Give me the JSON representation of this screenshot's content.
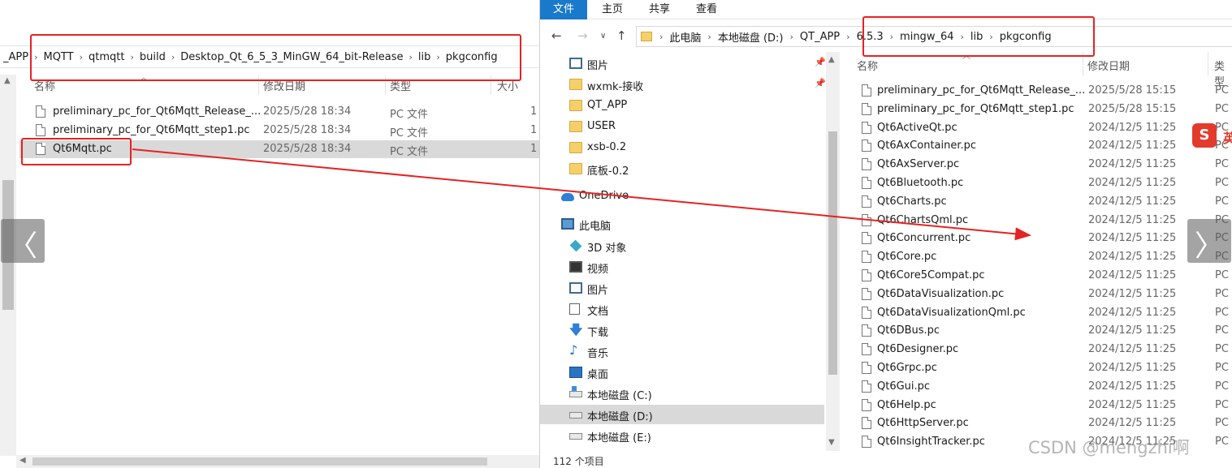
{
  "left_window": {
    "breadcrumbs": [
      "_APP",
      "MQTT",
      "qtmqtt",
      "build",
      "Desktop_Qt_6_5_3_MinGW_64_bit-Release",
      "lib",
      "pkgconfig"
    ],
    "columns": {
      "name": "名称",
      "date": "修改日期",
      "type": "类型",
      "size": "大小"
    },
    "files": [
      {
        "name": "preliminary_pc_for_Qt6Mqtt_Release_...",
        "date": "2025/5/28 18:34",
        "type": "PC 文件",
        "size": "1"
      },
      {
        "name": "preliminary_pc_for_Qt6Mqtt_step1.pc",
        "date": "2025/5/28 18:34",
        "type": "PC 文件",
        "size": "1"
      },
      {
        "name": "Qt6Mqtt.pc",
        "date": "2025/5/28 18:34",
        "type": "PC 文件",
        "size": "1"
      }
    ]
  },
  "right_window": {
    "ribbon_tabs": [
      "文件",
      "主页",
      "共享",
      "查看"
    ],
    "breadcrumbs": [
      "此电脑",
      "本地磁盘 (D:)",
      "QT_APP",
      "6.5.3",
      "mingw_64",
      "lib",
      "pkgconfig"
    ],
    "nav_items": [
      {
        "label": "图片",
        "icon": "image-icon",
        "pinned": true
      },
      {
        "label": "wxmk-接收",
        "icon": "folder-icon",
        "pinned": true
      },
      {
        "label": "QT_APP",
        "icon": "folder-icon"
      },
      {
        "label": "USER",
        "icon": "folder-icon"
      },
      {
        "label": "xsb-0.2",
        "icon": "folder-icon"
      },
      {
        "label": "底板-0.2",
        "icon": "folder-icon"
      },
      {
        "label": "OneDrive",
        "icon": "cloud-icon"
      },
      {
        "label": "此电脑",
        "icon": "computer-icon"
      },
      {
        "label": "3D 对象",
        "icon": "cube-icon"
      },
      {
        "label": "视频",
        "icon": "video-icon"
      },
      {
        "label": "图片",
        "icon": "image-icon"
      },
      {
        "label": "文档",
        "icon": "document-icon"
      },
      {
        "label": "下载",
        "icon": "download-icon"
      },
      {
        "label": "音乐",
        "icon": "music-icon"
      },
      {
        "label": "桌面",
        "icon": "desktop-icon"
      },
      {
        "label": "本地磁盘 (C:)",
        "icon": "drive-c-icon"
      },
      {
        "label": "本地磁盘 (D:)",
        "icon": "drive-icon",
        "selected": true
      },
      {
        "label": "本地磁盘 (E:)",
        "icon": "drive-icon"
      }
    ],
    "columns": {
      "name": "名称",
      "date": "修改日期",
      "type": "类型"
    },
    "files": [
      {
        "name": "preliminary_pc_for_Qt6Mqtt_Release_...",
        "date": "2025/5/28 15:15",
        "type": "PC"
      },
      {
        "name": "preliminary_pc_for_Qt6Mqtt_step1.pc",
        "date": "2025/5/28 15:15",
        "type": "PC"
      },
      {
        "name": "Qt6ActiveQt.pc",
        "date": "2024/12/5 11:25",
        "type": "PC"
      },
      {
        "name": "Qt6AxContainer.pc",
        "date": "2024/12/5 11:25",
        "type": "PC"
      },
      {
        "name": "Qt6AxServer.pc",
        "date": "2024/12/5 11:25",
        "type": "PC"
      },
      {
        "name": "Qt6Bluetooth.pc",
        "date": "2024/12/5 11:25",
        "type": "PC"
      },
      {
        "name": "Qt6Charts.pc",
        "date": "2024/12/5 11:25",
        "type": "PC"
      },
      {
        "name": "Qt6ChartsQml.pc",
        "date": "2024/12/5 11:25",
        "type": "PC"
      },
      {
        "name": "Qt6Concurrent.pc",
        "date": "2024/12/5 11:25",
        "type": "PC"
      },
      {
        "name": "Qt6Core.pc",
        "date": "2024/12/5 11:25",
        "type": "PC"
      },
      {
        "name": "Qt6Core5Compat.pc",
        "date": "2024/12/5 11:25",
        "type": "PC"
      },
      {
        "name": "Qt6DataVisualization.pc",
        "date": "2024/12/5 11:25",
        "type": "PC"
      },
      {
        "name": "Qt6DataVisualizationQml.pc",
        "date": "2024/12/5 11:25",
        "type": "PC"
      },
      {
        "name": "Qt6DBus.pc",
        "date": "2024/12/5 11:25",
        "type": "PC"
      },
      {
        "name": "Qt6Designer.pc",
        "date": "2024/12/5 11:25",
        "type": "PC"
      },
      {
        "name": "Qt6Grpc.pc",
        "date": "2024/12/5 11:25",
        "type": "PC"
      },
      {
        "name": "Qt6Gui.pc",
        "date": "2024/12/5 11:25",
        "type": "PC"
      },
      {
        "name": "Qt6Help.pc",
        "date": "2024/12/5 11:25",
        "type": "PC"
      },
      {
        "name": "Qt6HttpServer.pc",
        "date": "2024/12/5 11:25",
        "type": "PC"
      },
      {
        "name": "Qt6InsightTracker.pc",
        "date": "2024/12/5 11:25",
        "type": "PC"
      }
    ],
    "status": "112 个项目"
  },
  "ime_badge": {
    "logo": "S",
    "text": "英"
  },
  "watermark": "CSDN @mengzhi啊",
  "colors": {
    "annotation_red": "#e62222",
    "ribbon_active": "#1979ca",
    "selection_gray": "#d9d9d9"
  }
}
